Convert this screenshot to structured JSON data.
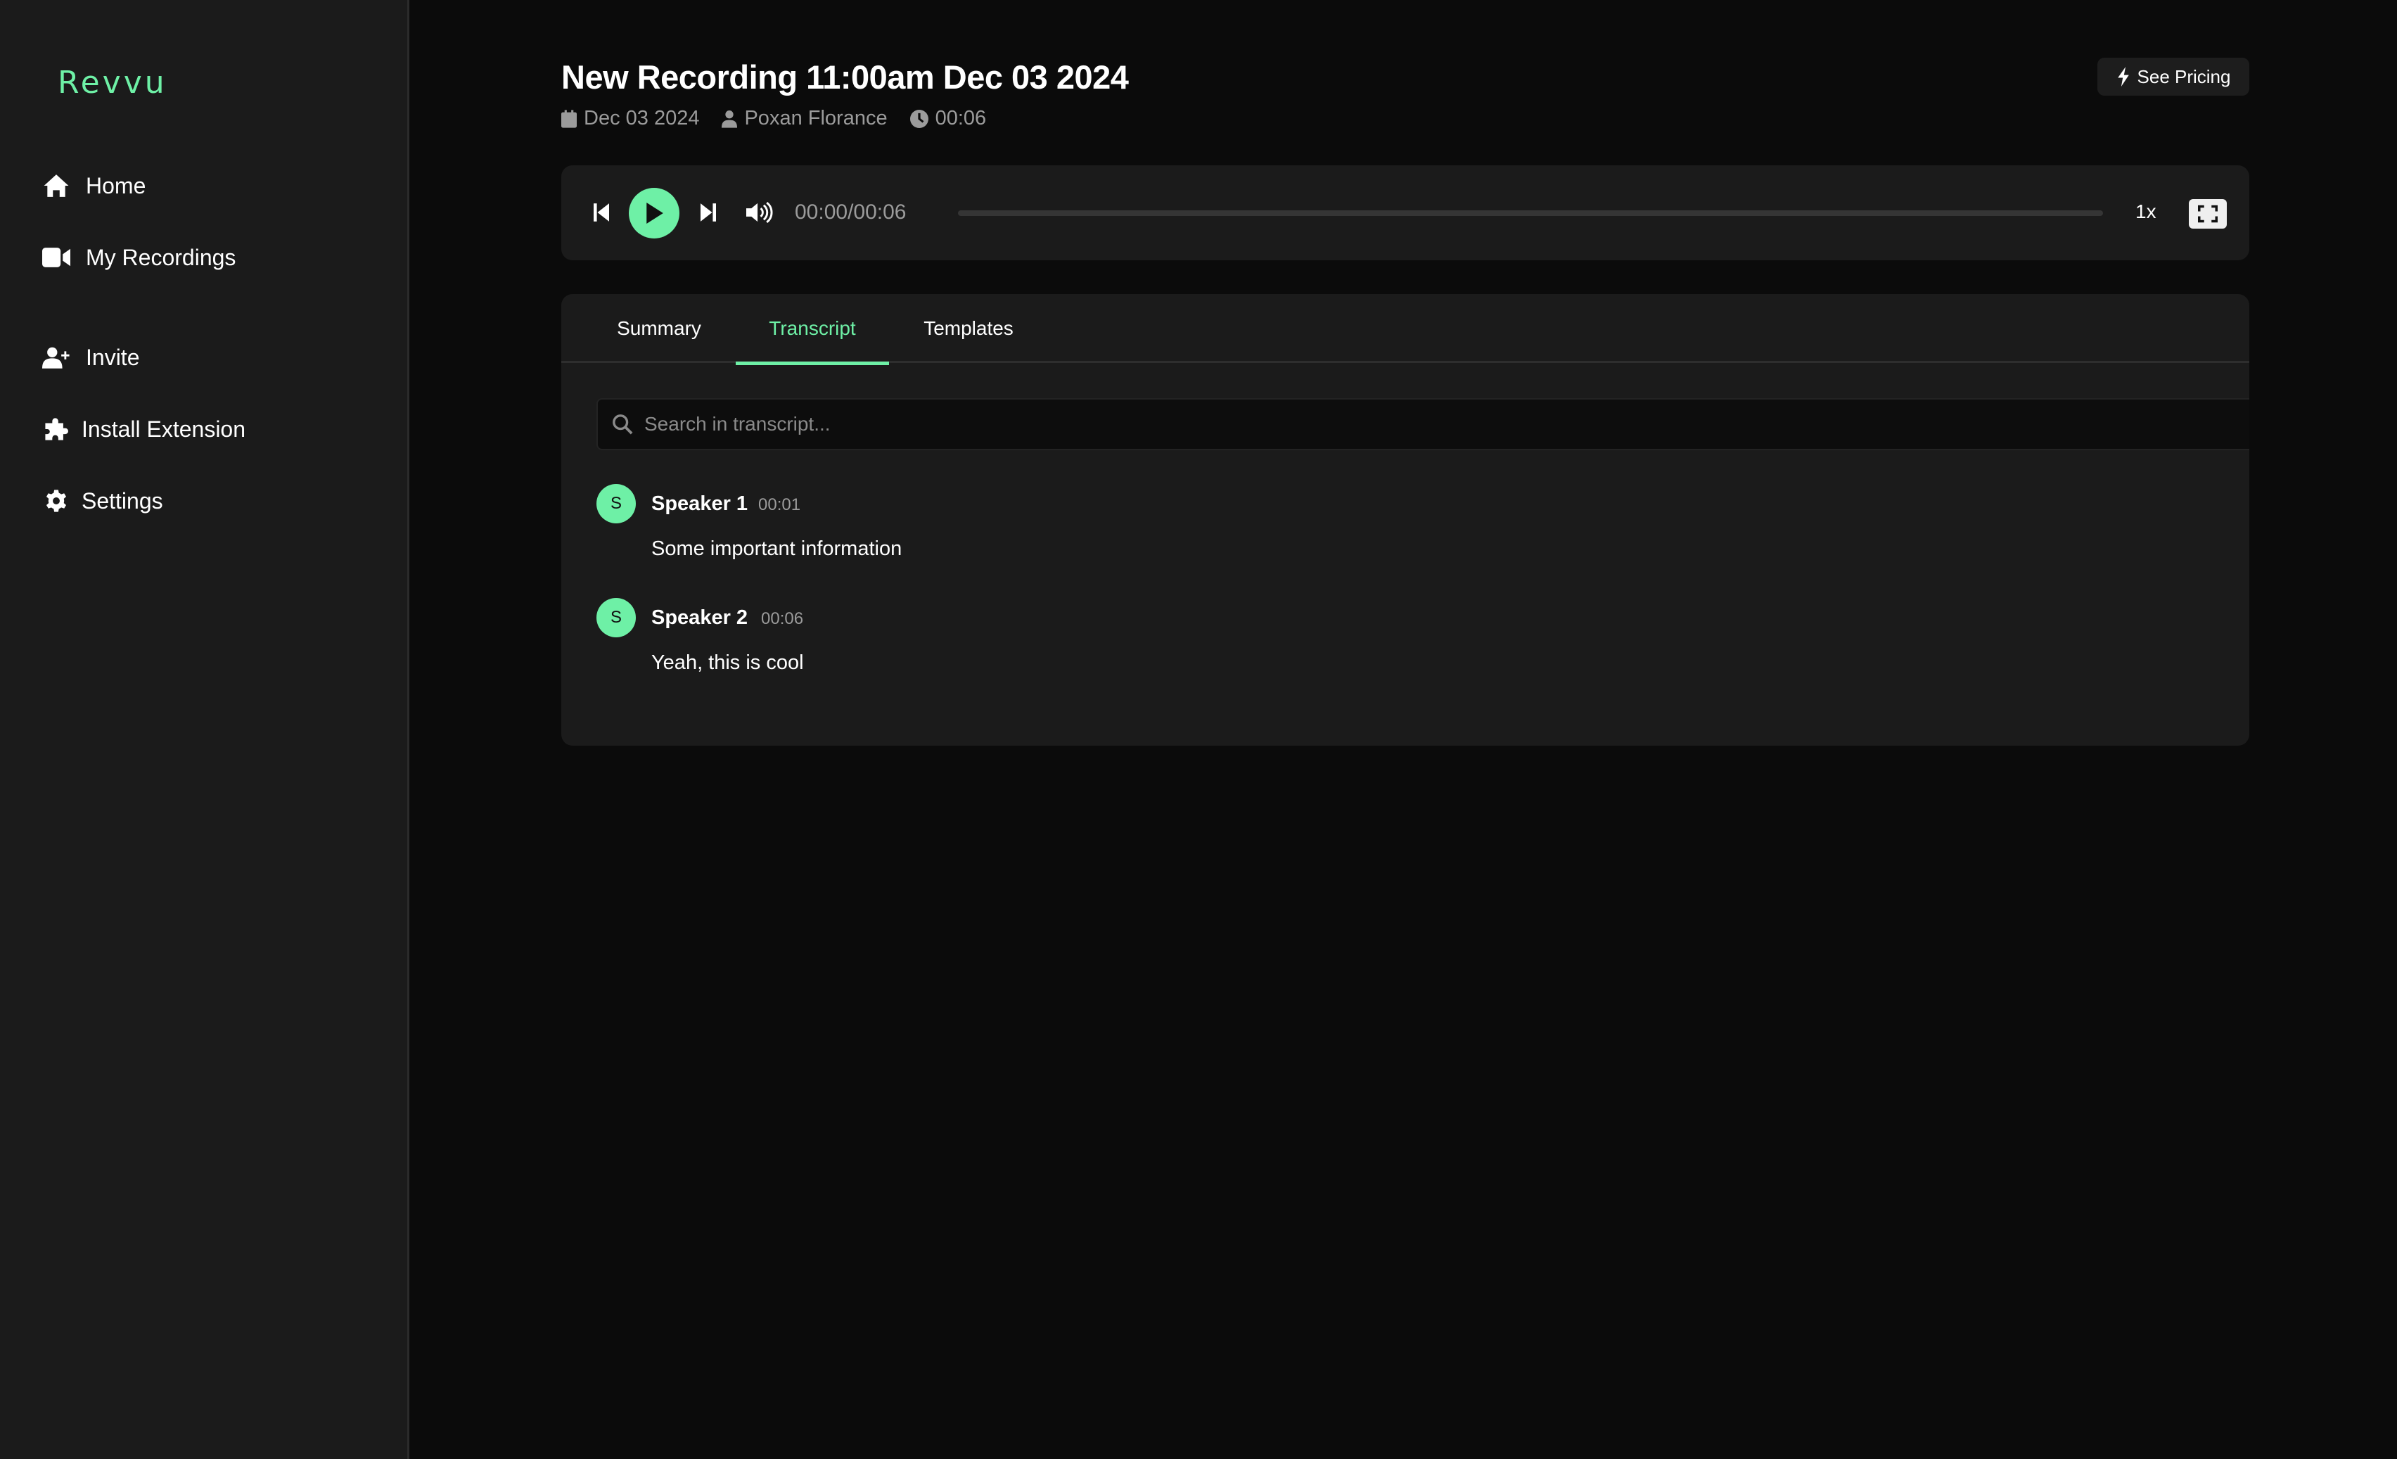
{
  "sidebar": {
    "logo": "Revvu",
    "items": [
      {
        "label": "Home",
        "icon": "home-icon"
      },
      {
        "label": "My Recordings",
        "icon": "video-camera-icon"
      },
      {
        "label": "Invite",
        "icon": "user-plus-icon"
      },
      {
        "label": "Install Extension",
        "icon": "puzzle-piece-icon"
      },
      {
        "label": "Settings",
        "icon": "gear-icon"
      }
    ]
  },
  "header": {
    "title": "New Recording 11:00am Dec 03 2024",
    "meta": {
      "date": "Dec 03 2024",
      "author": "Poxan Florance",
      "duration": "00:06"
    },
    "pricing_button": "See Pricing"
  },
  "player": {
    "time": "00:00/00:06",
    "progress_fraction": 0,
    "speed": "1x"
  },
  "tabs": [
    {
      "label": "Summary",
      "active": false
    },
    {
      "label": "Transcript",
      "active": true
    },
    {
      "label": "Templates",
      "active": false
    }
  ],
  "transcript": {
    "search_placeholder": "Search in transcript...",
    "search_value": "",
    "entries": [
      {
        "initial": "S",
        "speaker": "Speaker 1",
        "time": "00:01",
        "text": "Some important information"
      },
      {
        "initial": "S",
        "speaker": "Speaker 2",
        "time": "00:06",
        "text": "Yeah, this is cool"
      }
    ]
  },
  "colors": {
    "accent": "#6ef0a6",
    "sidebar_bg": "#1b1b1b",
    "main_bg": "#0b0b0b",
    "card_bg": "#1b1b1b",
    "muted_text": "#9b9b9b"
  }
}
